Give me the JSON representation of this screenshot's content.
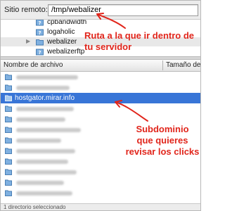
{
  "top_bar": {
    "label": "Sitio remoto:",
    "path": "/tmp/webalizer"
  },
  "tree": {
    "items": [
      {
        "label": "cpbandwidth"
      },
      {
        "label": "logaholic"
      },
      {
        "label": "webalizer"
      },
      {
        "label": "webalizerftp"
      }
    ]
  },
  "columns": {
    "name": "Nombre de archivo",
    "size": "Tamaño de a"
  },
  "files": {
    "selected_name": "hostgator.mirar.info"
  },
  "annotations": {
    "line1": "Ruta a la que ir dentro de",
    "line2": "tu servidor",
    "sub1": "Subdominio",
    "sub2": "que quieres",
    "sub3": "revisar los clicks"
  },
  "status": {
    "text": "1 directorio seleccionado"
  },
  "colors": {
    "annotation": "#e1251b",
    "selection": "#3875d7",
    "folder": "#7fb0e0"
  }
}
